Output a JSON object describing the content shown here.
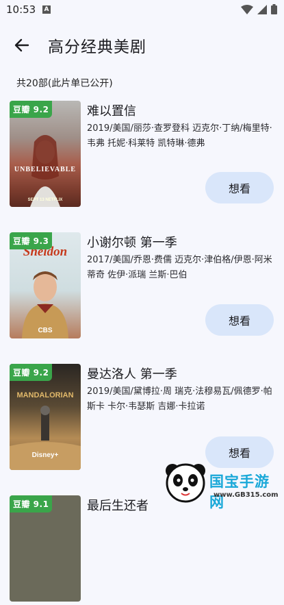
{
  "status_bar": {
    "time": "10:53",
    "notification_letter": "A"
  },
  "header": {
    "title": "高分经典美剧"
  },
  "list_summary": "共20部(此片单已公开)",
  "items": [
    {
      "badge": "豆瓣 9.2",
      "title": "难以置信",
      "meta": "2019/美国/丽莎·查罗登科 迈克尔·丁纳/梅里特·韦弗 托妮·科莱特 凯特琳·德弗",
      "button": "想看",
      "poster_text": "UNBELIEVABLE",
      "poster_small": "SEPT 13 NETFLIX"
    },
    {
      "badge": "豆瓣 9.3",
      "title": "小谢尔顿 第一季",
      "meta": "2017/美国/乔恩·费儒 迈克尔·津伯格/伊恩·阿米蒂奇 佐伊·派瑞 兰斯·巴伯",
      "button": "想看",
      "poster_text": "Sheldon",
      "poster_small": "CBS"
    },
    {
      "badge": "豆瓣 9.2",
      "title": "曼达洛人 第一季",
      "meta": "2019/美国/黛博拉·周 瑞克·法穆易瓦/佩德罗·帕斯卡 卡尔·韦瑟斯 吉娜·卡拉诺",
      "button": "想看",
      "poster_text": "MANDALORIAN",
      "poster_small": "Disney+"
    },
    {
      "badge": "豆瓣 9.1",
      "title": "最后生还者"
    }
  ],
  "watermark": {
    "name": "国宝手游网",
    "url": "www.GB315.com"
  },
  "colors": {
    "accent_button": "#d9e6fa",
    "badge_green": "#3aa54a",
    "background": "#f6f7fd"
  }
}
